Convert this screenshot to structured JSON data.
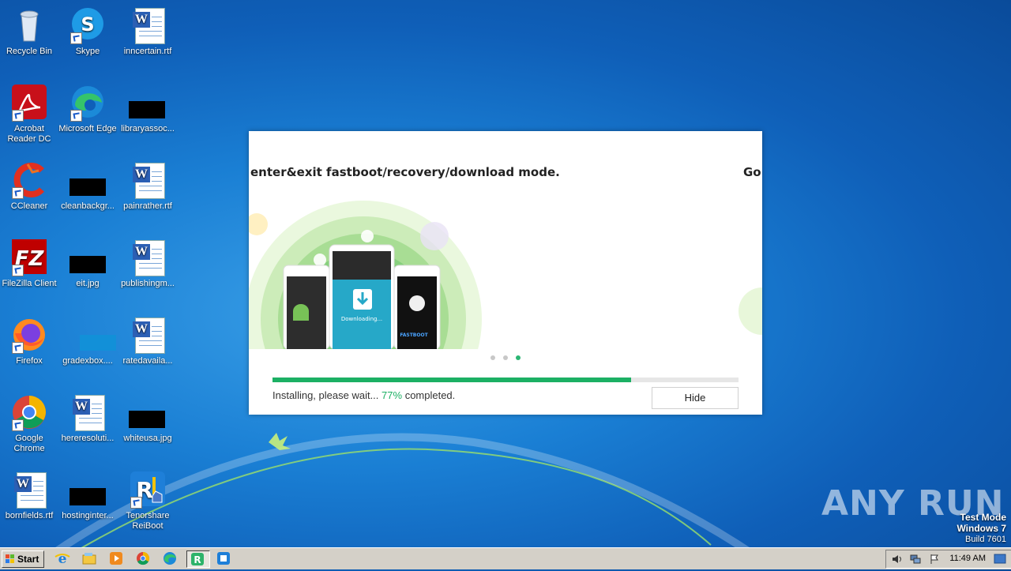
{
  "desktop": {
    "icons": [
      {
        "label": "Recycle Bin",
        "icon": "recycle-bin-icon"
      },
      {
        "label": "Skype",
        "icon": "skype-icon"
      },
      {
        "label": "inncertain.rtf",
        "icon": "word-doc-icon"
      },
      {
        "label": "Acrobat Reader DC",
        "icon": "acrobat-icon"
      },
      {
        "label": "Microsoft Edge",
        "icon": "edge-icon"
      },
      {
        "label": "libraryassoc...",
        "icon": "black-thumbnail-icon"
      },
      {
        "label": "CCleaner",
        "icon": "ccleaner-icon"
      },
      {
        "label": "cleanbackgr...",
        "icon": "black-thumbnail-icon"
      },
      {
        "label": "painrather.rtf",
        "icon": "word-doc-icon"
      },
      {
        "label": "FileZilla Client",
        "icon": "filezilla-icon"
      },
      {
        "label": "eit.jpg",
        "icon": "black-thumbnail-icon"
      },
      {
        "label": "publishingm...",
        "icon": "word-doc-icon"
      },
      {
        "label": "Firefox",
        "icon": "firefox-icon"
      },
      {
        "label": "gradexbox....",
        "icon": "blue-thumbnail-icon"
      },
      {
        "label": "ratedavaila...",
        "icon": "word-doc-icon"
      },
      {
        "label": "Google Chrome",
        "icon": "chrome-icon"
      },
      {
        "label": "hereresoluti...",
        "icon": "word-doc-icon"
      },
      {
        "label": "whiteusa.jpg",
        "icon": "black-thumbnail-icon"
      },
      {
        "label": "bornfields.rtf",
        "icon": "word-doc-icon"
      },
      {
        "label": "hostinginter...",
        "icon": "black-thumbnail-icon"
      },
      {
        "label": "Tenorshare ReiBoot",
        "icon": "reiboot-icon"
      }
    ]
  },
  "dialog": {
    "slide_title": "enter&exit fastboot/recovery/download mode.",
    "next_slide_title": "Go",
    "phone_screen_text": "Downloading...",
    "phone_badge": "FASTBOOT",
    "progress_percent": 77,
    "status_prefix": "Installing, please wait...",
    "status_percent": "77%",
    "status_suffix": "completed.",
    "hide_button": "Hide",
    "carousel_active_index": 2,
    "carousel_count": 3,
    "accent": "#1cb064"
  },
  "watermark": {
    "brand": "ANY RUN",
    "test_mode": "Test Mode",
    "os": "Windows 7",
    "build": "Build 7601"
  },
  "taskbar": {
    "start_label": "Start",
    "clock": "11:49 AM",
    "pinned": [
      "ie-icon",
      "explorer-icon",
      "media-player-icon",
      "chrome-icon",
      "edge-icon",
      "reiboot-icon",
      "reiboot-installer-icon"
    ]
  }
}
